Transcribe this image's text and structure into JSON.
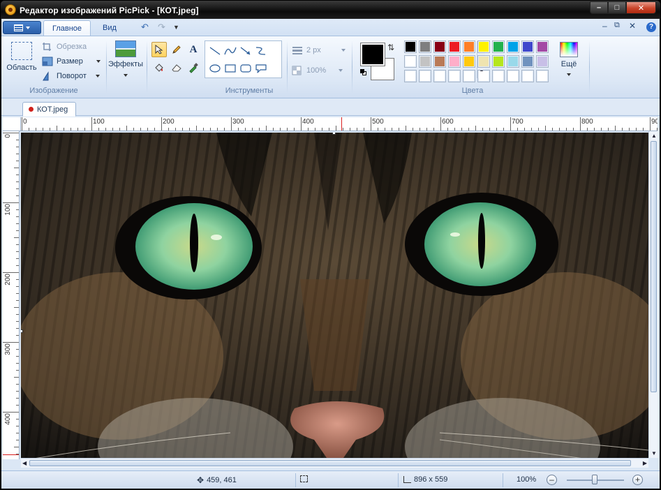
{
  "window": {
    "title": "Редактор изображений PicPick - [КОТ.jpeg]",
    "controls": [
      "minimize",
      "maximize",
      "close"
    ]
  },
  "ribbon_tabs": {
    "tabs": [
      {
        "label": "Главное",
        "active": true
      },
      {
        "label": "Вид",
        "active": false
      }
    ],
    "quick_access": [
      "undo-icon",
      "redo-icon",
      "customize-arrow-icon"
    ]
  },
  "groups": {
    "image": {
      "label": "Изображение",
      "select_label": "Область",
      "crop_label": "Обрезка",
      "resize_label": "Размер",
      "rotate_label": "Поворот",
      "effects_label": "Эффекты"
    },
    "tools": {
      "label": "Инструменты",
      "line_width": "2 px",
      "opacity": "100%"
    },
    "colors": {
      "label": "Цвета",
      "more_label": "Ещё",
      "primary": "#000000",
      "secondary": "#ffffff",
      "palette": [
        "#000000",
        "#7f7f7f",
        "#880015",
        "#ed1c24",
        "#ff7f27",
        "#fff200",
        "#22b14c",
        "#00a2e8",
        "#3f48cc",
        "#a349a4",
        "#ffffff",
        "#c3c3c3",
        "#b97a57",
        "#ffaec9",
        "#ffc90e",
        "#efe4b0",
        "#b5e61d",
        "#99d9ea",
        "#7092be",
        "#c8bfe7",
        "#ffffff",
        "#ffffff",
        "#ffffff",
        "#ffffff",
        "#ffffff",
        "#ffffff",
        "#ffffff",
        "#ffffff",
        "#ffffff",
        "#ffffff"
      ]
    }
  },
  "document": {
    "tab_label": "КОТ.jpeg"
  },
  "rulers": {
    "horizontal": [
      "0",
      "100",
      "200",
      "300",
      "400",
      "500",
      "600",
      "700",
      "800",
      "90"
    ],
    "vertical": [
      "0",
      "100",
      "200",
      "300",
      "400"
    ]
  },
  "status": {
    "cursor": "459, 461",
    "selection": "",
    "image_size": "896 x 559",
    "zoom": "100%"
  }
}
